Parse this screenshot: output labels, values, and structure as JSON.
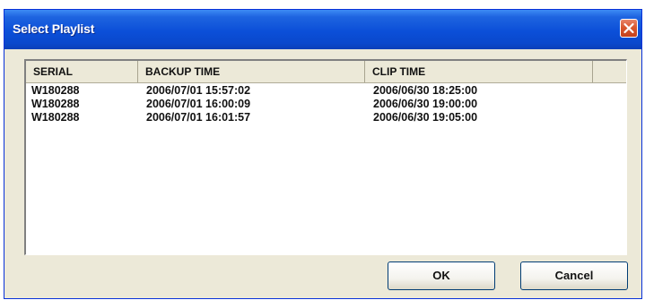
{
  "window": {
    "title": "Select Playlist",
    "close_icon": "close-icon"
  },
  "colors": {
    "title_bar": "#0b4fd8",
    "close_button": "#d9582f",
    "dialog_background": "#ece9d8"
  },
  "list": {
    "columns": [
      "SERIAL",
      "BACKUP TIME",
      "CLIP TIME",
      ""
    ],
    "rows": [
      {
        "serial": "W180288",
        "backup_time": "2006/07/01 15:57:02",
        "clip_time": "2006/06/30 18:25:00"
      },
      {
        "serial": "W180288",
        "backup_time": "2006/07/01 16:00:09",
        "clip_time": "2006/06/30 19:00:00"
      },
      {
        "serial": "W180288",
        "backup_time": "2006/07/01 16:01:57",
        "clip_time": "2006/06/30 19:05:00"
      }
    ]
  },
  "buttons": {
    "ok_label": "OK",
    "cancel_label": "Cancel"
  }
}
